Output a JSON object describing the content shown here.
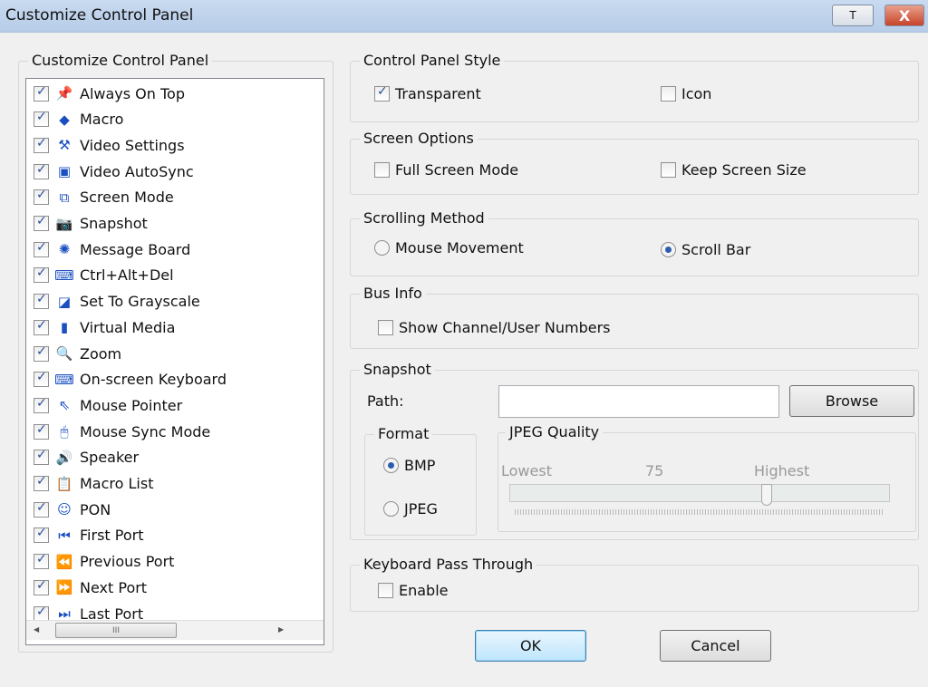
{
  "window": {
    "title": "Customize Control Panel",
    "pin_label": "T",
    "close_label": "X"
  },
  "left": {
    "group_label": "Customize Control Panel",
    "items": [
      {
        "label": "Always On Top",
        "checked": true,
        "icon": "pin-icon",
        "glyph": "📌"
      },
      {
        "label": "Macro",
        "checked": true,
        "icon": "macro-cube-icon",
        "glyph": "◆"
      },
      {
        "label": "Video Settings",
        "checked": true,
        "icon": "hammer-icon",
        "glyph": "⚒"
      },
      {
        "label": "Video AutoSync",
        "checked": true,
        "icon": "autosync-icon",
        "glyph": "▣"
      },
      {
        "label": "Screen Mode",
        "checked": true,
        "icon": "screen-mode-icon",
        "glyph": "⧉"
      },
      {
        "label": "Snapshot",
        "checked": true,
        "icon": "camera-icon",
        "glyph": "📷"
      },
      {
        "label": "Message Board",
        "checked": true,
        "icon": "message-board-icon",
        "glyph": "✺"
      },
      {
        "label": "Ctrl+Alt+Del",
        "checked": true,
        "icon": "ctrl-alt-del-icon",
        "glyph": "⌨"
      },
      {
        "label": "Set To Grayscale",
        "checked": true,
        "icon": "grayscale-icon",
        "glyph": "◪"
      },
      {
        "label": "Virtual Media",
        "checked": true,
        "icon": "usb-drive-icon",
        "glyph": "▮"
      },
      {
        "label": "Zoom",
        "checked": true,
        "icon": "magnifier-icon",
        "glyph": "🔍"
      },
      {
        "label": "On-screen Keyboard",
        "checked": true,
        "icon": "keyboard-icon",
        "glyph": "⌨"
      },
      {
        "label": "Mouse Pointer",
        "checked": true,
        "icon": "mouse-pointer-icon",
        "glyph": "⇖"
      },
      {
        "label": "Mouse Sync Mode",
        "checked": true,
        "icon": "mouse-icon",
        "glyph": "🖱"
      },
      {
        "label": "Speaker",
        "checked": true,
        "icon": "speaker-icon",
        "glyph": "🔊"
      },
      {
        "label": "Macro List",
        "checked": true,
        "icon": "macro-list-icon",
        "glyph": "📋"
      },
      {
        "label": "PON",
        "checked": true,
        "icon": "pon-icon",
        "glyph": "☺"
      },
      {
        "label": "First Port",
        "checked": true,
        "icon": "first-port-icon",
        "glyph": "⏮"
      },
      {
        "label": "Previous Port",
        "checked": true,
        "icon": "previous-port-icon",
        "glyph": "⏪"
      },
      {
        "label": "Next Port",
        "checked": true,
        "icon": "next-port-icon",
        "glyph": "⏩"
      },
      {
        "label": "Last Port",
        "checked": true,
        "icon": "last-port-icon",
        "glyph": "⏭"
      }
    ]
  },
  "style": {
    "label": "Control Panel Style",
    "transparent": "Transparent",
    "transparent_checked": true,
    "icon": "Icon",
    "icon_checked": false
  },
  "screen": {
    "label": "Screen Options",
    "full": "Full Screen Mode",
    "keep": "Keep Screen Size"
  },
  "scrolling": {
    "label": "Scrolling Method",
    "mouse": "Mouse Movement",
    "scrollbar": "Scroll Bar",
    "selected": "Scroll Bar"
  },
  "bus": {
    "label": "Bus Info",
    "show": "Show Channel/User Numbers"
  },
  "snapshot": {
    "label": "Snapshot",
    "path_label": "Path:",
    "path_value": "",
    "browse": "Browse",
    "format_label": "Format",
    "bmp": "BMP",
    "jpeg": "JPEG",
    "selected_format": "BMP",
    "quality": {
      "label": "JPEG Quality",
      "lowest": "Lowest",
      "highest": "Highest",
      "value": "75",
      "slider_fraction": 0.68
    }
  },
  "keyboard": {
    "label": "Keyboard Pass Through",
    "enable": "Enable"
  },
  "buttons": {
    "ok": "OK",
    "cancel": "Cancel"
  },
  "scroll": {
    "up": "▲",
    "down": "▼",
    "left": "◀",
    "right": "▶",
    "grip": "≡",
    "hgrip": "III"
  }
}
